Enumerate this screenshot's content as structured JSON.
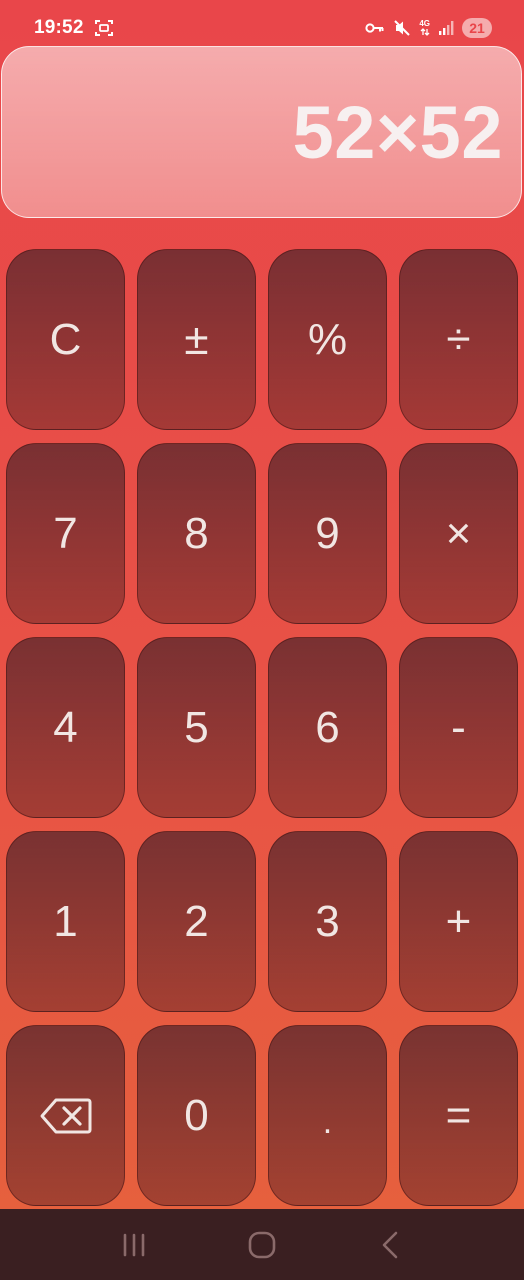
{
  "status_bar": {
    "time": "19:52",
    "network_label": "4G",
    "battery": "21"
  },
  "display": {
    "expression": "52×52"
  },
  "keypad": {
    "rows": [
      [
        {
          "label": "C",
          "name": "clear-button"
        },
        {
          "label": "±",
          "name": "plus-minus-button"
        },
        {
          "label": "%",
          "name": "percent-button"
        },
        {
          "label": "÷",
          "name": "divide-button"
        }
      ],
      [
        {
          "label": "7",
          "name": "digit-7-button"
        },
        {
          "label": "8",
          "name": "digit-8-button"
        },
        {
          "label": "9",
          "name": "digit-9-button"
        },
        {
          "label": "×",
          "name": "multiply-button"
        }
      ],
      [
        {
          "label": "4",
          "name": "digit-4-button"
        },
        {
          "label": "5",
          "name": "digit-5-button"
        },
        {
          "label": "6",
          "name": "digit-6-button"
        },
        {
          "label": "-",
          "name": "subtract-button"
        }
      ],
      [
        {
          "label": "1",
          "name": "digit-1-button"
        },
        {
          "label": "2",
          "name": "digit-2-button"
        },
        {
          "label": "3",
          "name": "digit-3-button"
        },
        {
          "label": "+",
          "name": "add-button"
        }
      ],
      [
        {
          "label": "",
          "name": "backspace-button",
          "icon": "backspace-icon"
        },
        {
          "label": "0",
          "name": "digit-0-button"
        },
        {
          "label": ".",
          "name": "decimal-button"
        },
        {
          "label": "=",
          "name": "equals-button"
        }
      ]
    ]
  },
  "nav_bar": {
    "items": [
      "recent-apps-icon",
      "home-icon",
      "back-icon"
    ]
  },
  "colors": {
    "background_top": "#e9464a",
    "background_bottom": "#e6603d",
    "key_fill": "#6e2a2d",
    "nav_bar": "#3a1f21",
    "text": "#f1e6e3"
  }
}
